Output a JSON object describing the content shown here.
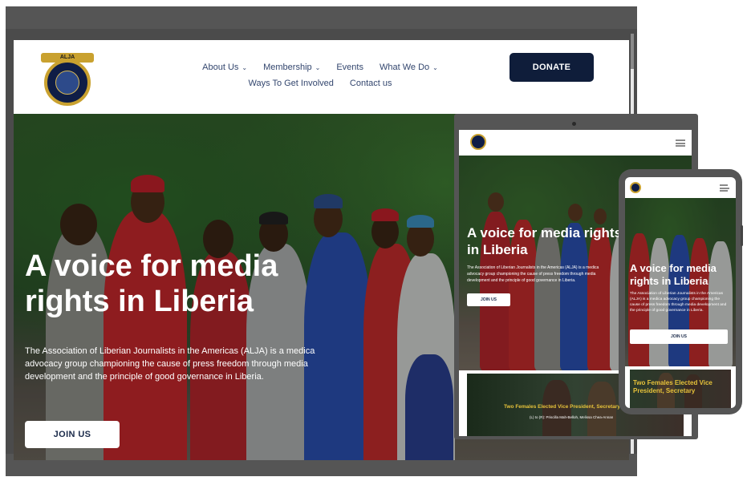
{
  "header": {
    "logo_text": "ALJA",
    "nav_row1": [
      {
        "label": "About Us",
        "has_dropdown": true
      },
      {
        "label": "Membership",
        "has_dropdown": true
      },
      {
        "label": "Events",
        "has_dropdown": false
      },
      {
        "label": "What We Do",
        "has_dropdown": true
      }
    ],
    "nav_row2": [
      {
        "label": "Ways To Get Involved"
      },
      {
        "label": "Contact us"
      }
    ],
    "donate_label": "DONATE"
  },
  "hero": {
    "title": "A voice for media rights in Liberia",
    "description": "The Association of Liberian Journalists in the Americas (ALJA) is a medica advocacy group championing the cause of press freedom through media development and the principle of good governance in Liberia.",
    "join_label": "JOIN US"
  },
  "tablet": {
    "hero_title": "A voice for media rights in Liberia",
    "hero_description": "The Association of Liberian Journalists in the Americas (ALJA) is a medica advocacy group championing the cause of press freedom through media development and the principle of good governance in Liberia.",
    "join_label": "JOIN US",
    "card_title": "Two Females Elected Vice President, Secretary",
    "card_subtitle": "(L) to (R): Priscilla Mah-Belloh, Melissa Chea-Annan"
  },
  "phone": {
    "hero_title": "A voice for media rights in Liberia",
    "hero_description": "The Association of Liberian Journalists in the Americas (ALJA) is a medica advocacy group championing the cause of press freedom through media development and the principle of good governance in Liberia.",
    "join_label": "JOIN US",
    "card_title": "Two Females Elected Vice President, Secretary"
  },
  "colors": {
    "navy": "#0f1d3a",
    "nav_text": "#33466e",
    "gold": "#c9a12f",
    "card_gold": "#e6c23a"
  },
  "icons": {
    "dropdown": "chevron-down-icon",
    "menu": "hamburger-menu-icon"
  }
}
